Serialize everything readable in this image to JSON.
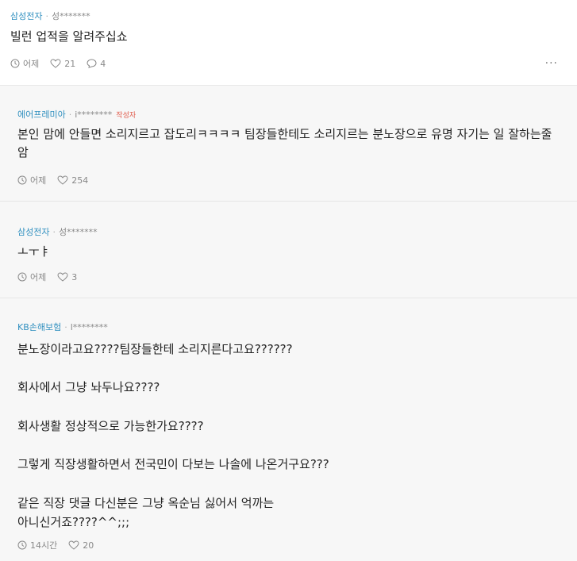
{
  "post": {
    "company": "삼성전자",
    "separator": "·",
    "user": "성*******",
    "title": "빌런 업적을 알려주십쇼",
    "time": "어제",
    "likes": "21",
    "comments": "4",
    "more": "···"
  },
  "comments": [
    {
      "company": "에어프레미아",
      "separator": "·",
      "user": "i********",
      "author_tag": "작성자",
      "text": "본인 맘에 안들면 소리지르고 잡도리ㅋㅋㅋㅋ 팀장들한테도 소리지르는 분노장으로 유명 자기는 일 잘하는줄\n암",
      "time": "어제",
      "likes": "254"
    },
    {
      "company": "삼성전자",
      "separator": "·",
      "user": "성*******",
      "text": "ㅗㅜㅑ",
      "time": "어제",
      "likes": "3"
    },
    {
      "company": "KB손해보험",
      "separator": "·",
      "user": "l********",
      "text": "분노장이라고요????팀장들한테 소리지른다고요??????\n\n회사에서 그냥 놔두나요????\n\n회사생활 정상적으로 가능한가요????\n\n그렇게 직장생활하면서 전국민이 다보는 나솔에 나온거구요???\n\n같은 직장 댓글 다신분은 그냥 옥순님 싫어서 억까는\n아니신거죠????^^;;;",
      "time": "14시간",
      "likes": "20"
    }
  ]
}
